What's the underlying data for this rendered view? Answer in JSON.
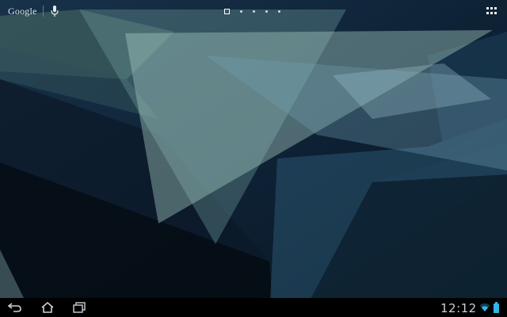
{
  "search_bar": {
    "logo_text": "Google",
    "mic_icon": "microphone-icon"
  },
  "home": {
    "page_count": 5,
    "active_page_index": 0
  },
  "apps_button": {
    "icon": "apps-grid-icon"
  },
  "navigation": {
    "back_icon": "back-arrow-icon",
    "home_icon": "home-icon",
    "recents_icon": "recent-apps-icon"
  },
  "status": {
    "time": "12:12",
    "wifi_icon": "wifi-icon",
    "battery_icon": "battery-icon",
    "accent_color": "#33b5e5"
  }
}
